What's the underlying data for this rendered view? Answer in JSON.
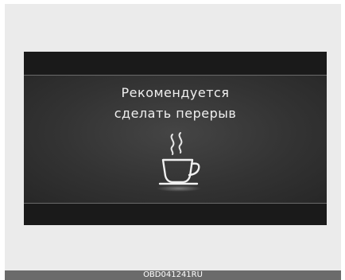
{
  "screen": {
    "line1": "Рекомендуется",
    "line2": "сделать перерыв",
    "icon": "coffee-cup-icon"
  },
  "caption": "OBD041241RU",
  "colors": {
    "display_bg": "#1c1c1c",
    "panel_bg": "#333333",
    "text": "#f0f0f0",
    "caption_bar": "#6b6b6b"
  }
}
